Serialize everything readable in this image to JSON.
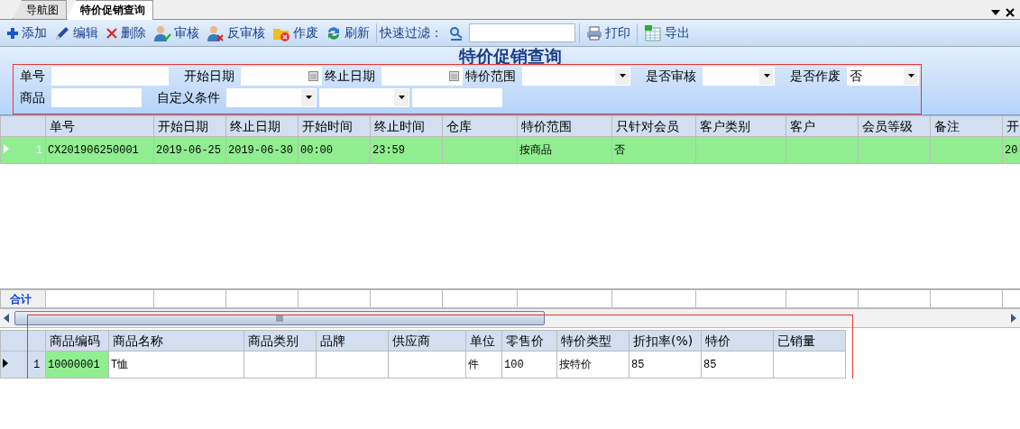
{
  "doc_tabs": [
    {
      "label": "导航图",
      "selected": false
    },
    {
      "label": "特价促销查询",
      "selected": true
    }
  ],
  "toolbar": {
    "buttons": [
      {
        "label": "添加"
      },
      {
        "label": "编辑"
      },
      {
        "label": "删除"
      },
      {
        "label": "审核"
      },
      {
        "label": "反审核"
      },
      {
        "label": "作废"
      },
      {
        "label": "刷新"
      }
    ],
    "filter_label": "快速过滤：",
    "buttons_right": [
      {
        "label": "打印"
      },
      {
        "label": "导出"
      }
    ]
  },
  "filter_panel": {
    "title": "特价促销查询",
    "rows": [
      [
        {
          "kind": "label",
          "text": "单号"
        },
        {
          "kind": "text"
        },
        {
          "kind": "label",
          "text": "开始日期"
        },
        {
          "kind": "date"
        },
        {
          "kind": "label",
          "text": "终止日期"
        },
        {
          "kind": "date"
        },
        {
          "kind": "label",
          "text": "特价范围"
        },
        {
          "kind": "select"
        },
        {
          "kind": "label",
          "text": "是否审核"
        },
        {
          "kind": "select"
        },
        {
          "kind": "label",
          "text": "是否作废"
        },
        {
          "kind": "select",
          "value": "否"
        }
      ],
      [
        {
          "kind": "label",
          "text": "商品"
        },
        {
          "kind": "text"
        },
        {
          "kind": "label",
          "text": "自定义条件"
        },
        {
          "kind": "select"
        },
        {
          "kind": "select"
        },
        {
          "kind": "text"
        }
      ]
    ]
  },
  "master_table": {
    "columns": [
      "单号",
      "开始日期",
      "终止日期",
      "开始时间",
      "终止时间",
      "仓库",
      "特价范围",
      "只针对会员",
      "客户类别",
      "客户",
      "会员等级",
      "备注",
      "开"
    ],
    "rows": [
      {
        "number": "1",
        "selected": true,
        "cells": [
          "CX201906250001",
          "2019-06-25",
          "2019-06-30",
          "00:00",
          "23:59",
          "",
          "按商品",
          "否",
          "",
          "",
          "",
          "",
          "20"
        ]
      }
    ],
    "totals_label": "合计"
  },
  "detail_table": {
    "columns": [
      "商品编码",
      "商品名称",
      "商品类别",
      "品牌",
      "供应商",
      "单位",
      "零售价",
      "特价类型",
      "折扣率(%)",
      "特价",
      "已销量"
    ],
    "rows": [
      {
        "number": "1",
        "selected": true,
        "cells": [
          "10000001",
          "T恤",
          "",
          "",
          "",
          "件",
          "100",
          "按特价",
          "85",
          "85",
          ""
        ]
      }
    ]
  }
}
